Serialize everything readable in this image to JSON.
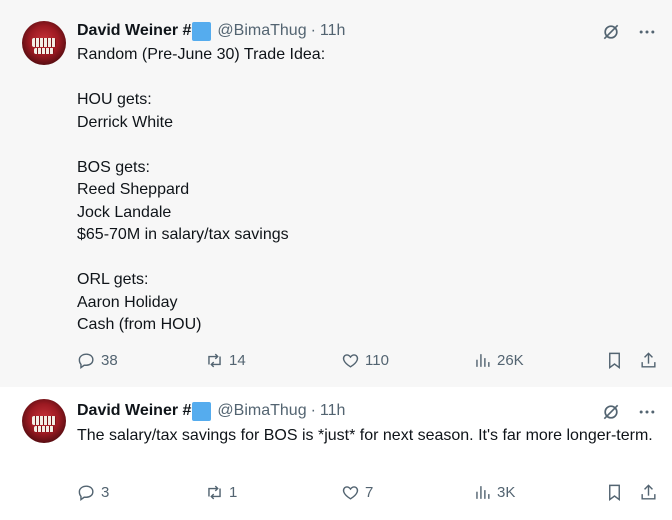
{
  "tweets": [
    {
      "author_name": "David Weiner #",
      "handle": "@BimaThug",
      "separator": "·",
      "time": "11h",
      "text": "Random (Pre-June 30) Trade Idea:\n\nHOU gets:\nDerrick White\n\nBOS gets:\nReed Sheppard\nJock Landale\n$65-70M in salary/tax savings\n\nORL gets:\nAaron Holiday\nCash (from HOU)",
      "replies": "38",
      "reposts": "14",
      "likes": "110",
      "views": "26K"
    },
    {
      "author_name": "David Weiner #",
      "handle": "@BimaThug",
      "separator": "·",
      "time": "11h",
      "text": "The salary/tax savings for BOS is *just* for next season. It's far more longer-term.",
      "replies": "3",
      "reposts": "1",
      "likes": "7",
      "views": "3K"
    }
  ],
  "icons": {
    "header_actions": [
      "grok-icon",
      "more-icon"
    ],
    "actions": [
      "reply-icon",
      "repost-icon",
      "like-icon",
      "views-icon",
      "bookmark-icon",
      "share-icon"
    ]
  },
  "colors": {
    "flag_badge": "#55acee",
    "secondary_text": "#536471",
    "thread_line": "#cfd9de",
    "highlight_bg": "#f7f7f7"
  }
}
